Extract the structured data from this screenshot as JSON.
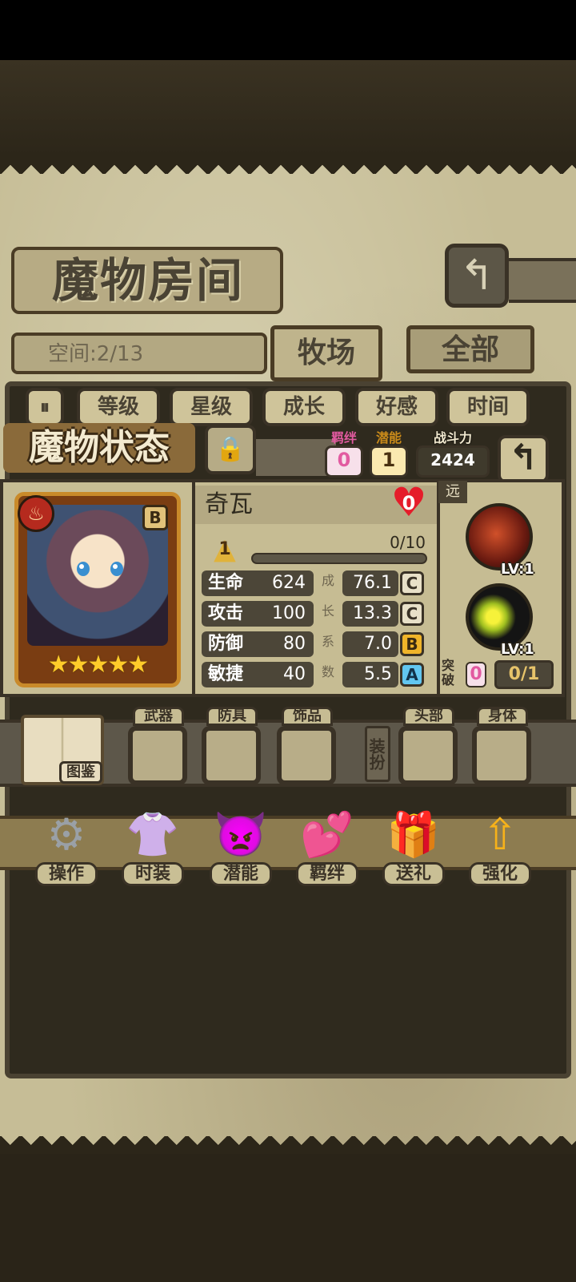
{
  "room": {
    "title": "魔物房间",
    "back_icon": "return-arrow-icon",
    "space": "空间:2/13",
    "tabs": [
      {
        "label": "牧场"
      },
      {
        "label": "全部"
      }
    ]
  },
  "sort": {
    "buttons": [
      {
        "label": "等级"
      },
      {
        "label": "星级"
      },
      {
        "label": "成长"
      },
      {
        "label": "好感"
      },
      {
        "label": "时间"
      }
    ]
  },
  "status": {
    "title": "魔物状态",
    "bond": {
      "label": "羁绊",
      "value": "0"
    },
    "potential": {
      "label": "潜能",
      "value": "1"
    },
    "power": {
      "label": "战斗力",
      "value": "2424"
    },
    "lock_icon": "lock-icon"
  },
  "monster": {
    "name": "奇瓦",
    "heart_value": "0",
    "rank": "B",
    "element_icon": "fire-icon",
    "stars": "★★★★★",
    "star_count": 5,
    "level": "1",
    "xp": "0/10",
    "xp_fraction": 0.0,
    "stats": [
      {
        "label": "生命",
        "value": "624",
        "growth": "76.1",
        "grade": "C"
      },
      {
        "label": "攻击",
        "value": "100",
        "growth": "13.3",
        "grade": "C"
      },
      {
        "label": "防御",
        "value": "80",
        "growth": "7.0",
        "grade": "B"
      },
      {
        "label": "敏捷",
        "value": "40",
        "growth": "5.5",
        "grade": "A"
      }
    ],
    "growth_vertical": [
      "成",
      "长",
      "系",
      "数"
    ]
  },
  "skills": {
    "range": "远",
    "items": [
      {
        "level": "LV:1"
      },
      {
        "level": "LV:1"
      }
    ],
    "breakthrough_label": "突破",
    "breakthrough_count": "0",
    "breakthrough_progress": "0/1"
  },
  "equipment": {
    "codex_label": "图鉴",
    "slots": [
      {
        "label": "武器"
      },
      {
        "label": "防具"
      },
      {
        "label": "饰品"
      },
      {
        "label": "头部"
      },
      {
        "label": "身体"
      }
    ],
    "dressup_label": "装扮"
  },
  "actions": [
    {
      "label": "操作",
      "icon": "gear-icon"
    },
    {
      "label": "时装",
      "icon": "clothes-icon"
    },
    {
      "label": "潜能",
      "icon": "demon-icon"
    },
    {
      "label": "羁绊",
      "icon": "hearts-icon"
    },
    {
      "label": "送礼",
      "icon": "gift-icon"
    },
    {
      "label": "强化",
      "icon": "upgrade-arrows-icon"
    }
  ],
  "colors": {
    "grade_C": "#e8e0c8",
    "grade_B": "#f0b429",
    "grade_A": "#62c6f0",
    "bond_pink": "#e25aa0",
    "potential_gold": "#e6b23a"
  }
}
